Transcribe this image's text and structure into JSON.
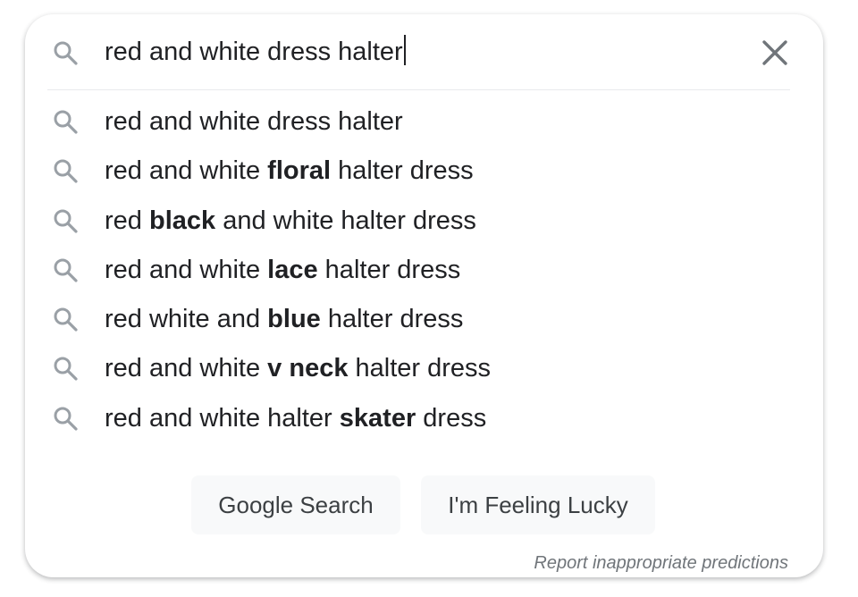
{
  "search": {
    "query": "red and white dress halter",
    "search_icon": "search-icon",
    "clear_icon": "close-icon"
  },
  "suggestions": [
    {
      "pre": "red and white dress halter",
      "bold": "",
      "post": ""
    },
    {
      "pre": "red and white ",
      "bold": "floral",
      "post": " halter dress"
    },
    {
      "pre": "red ",
      "bold": "black",
      "post": " and white halter dress"
    },
    {
      "pre": "red and white ",
      "bold": "lace",
      "post": " halter dress"
    },
    {
      "pre": "red white and ",
      "bold": "blue",
      "post": " halter dress"
    },
    {
      "pre": "red and white ",
      "bold": "v neck",
      "post": " halter dress"
    },
    {
      "pre": "red and white halter ",
      "bold": "skater",
      "post": " dress"
    }
  ],
  "buttons": {
    "search_label": "Google Search",
    "lucky_label": "I'm Feeling Lucky"
  },
  "report_label": "Report inappropriate predictions",
  "colors": {
    "text": "#202124",
    "icon": "#9aa0a6",
    "button_bg": "#f8f9fa",
    "button_text": "#3c4043",
    "muted": "#70757a"
  }
}
